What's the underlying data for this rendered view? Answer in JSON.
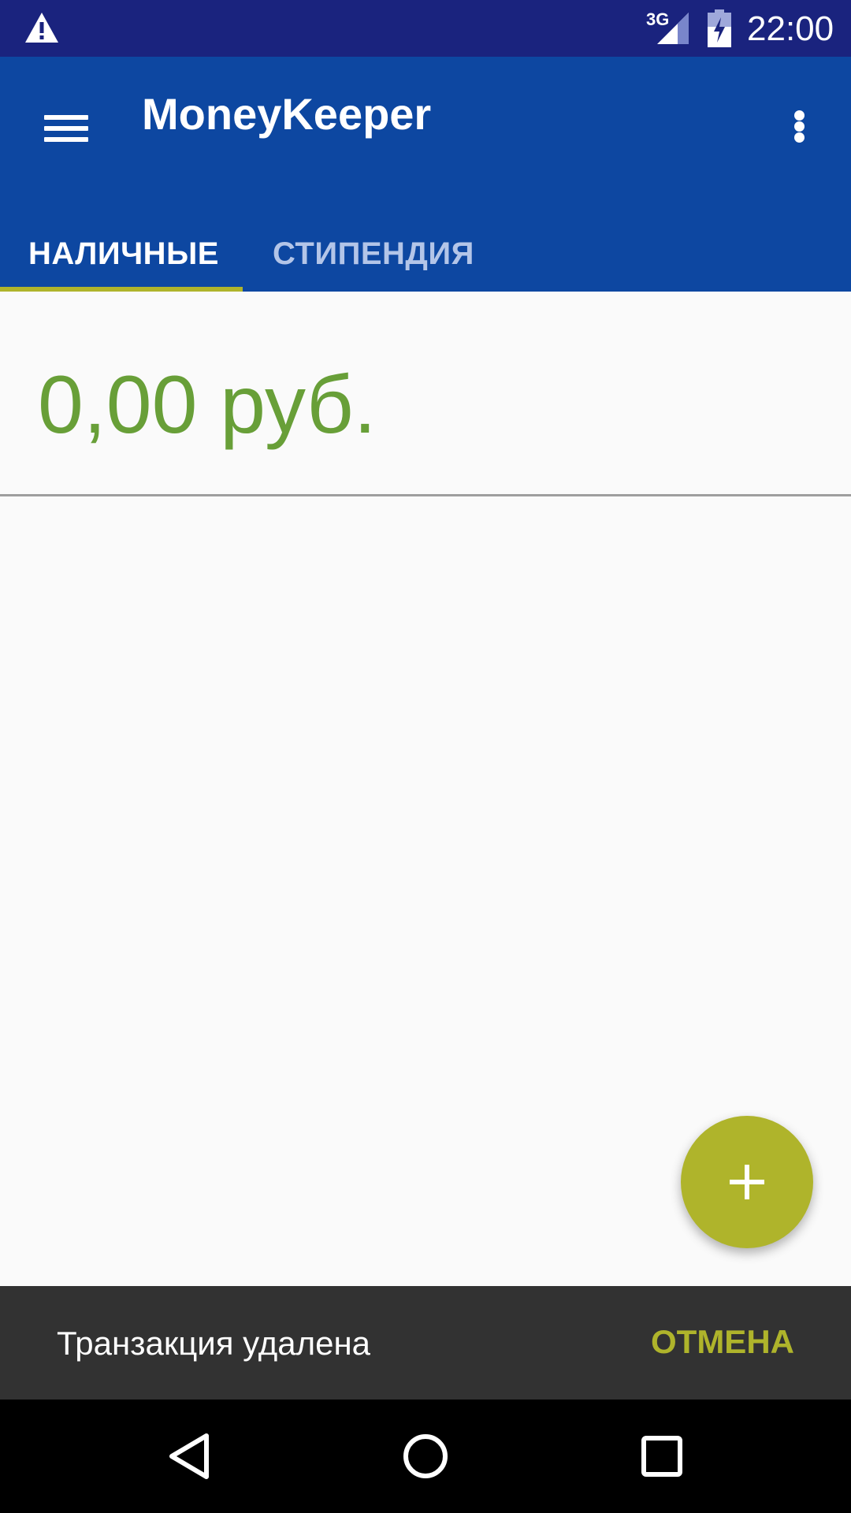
{
  "status_bar": {
    "network": "3G",
    "time": "22:00",
    "icons": [
      "warning-icon",
      "signal-icon",
      "battery-charging-icon"
    ]
  },
  "app_bar": {
    "title": "MoneyKeeper",
    "menu_icon": "hamburger-menu-icon",
    "overflow_icon": "more-vert-icon"
  },
  "tabs": [
    {
      "label": "НАЛИЧНЫЕ",
      "selected": true
    },
    {
      "label": "СТИПЕНДИЯ",
      "selected": false
    }
  ],
  "balance": {
    "amount": "0,00 руб."
  },
  "fab": {
    "icon": "plus-icon"
  },
  "snackbar": {
    "message": "Транзакция удалена",
    "action": "ОТМЕНА"
  },
  "nav_bar": {
    "icons": [
      "back-icon",
      "home-icon",
      "recents-icon"
    ]
  },
  "colors": {
    "status_bar": "#1a237e",
    "primary": "#0d47a1",
    "accent": "#afb42b",
    "balance_green": "#689f38",
    "snackbar_bg": "#323232"
  }
}
